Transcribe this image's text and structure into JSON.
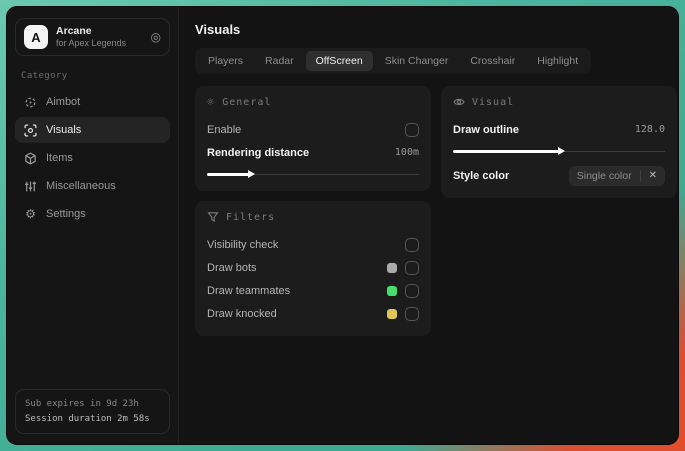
{
  "app": {
    "name": "Arcane",
    "subtitle": "for Apex Legends",
    "logo_letter": "A"
  },
  "sidebar": {
    "category_label": "Category",
    "items": [
      {
        "label": "Aimbot",
        "icon": "crosshair-icon",
        "active": false
      },
      {
        "label": "Visuals",
        "icon": "eye-scan-icon",
        "active": true
      },
      {
        "label": "Items",
        "icon": "cube-icon",
        "active": false
      },
      {
        "label": "Miscellaneous",
        "icon": "sliders-icon",
        "active": false
      },
      {
        "label": "Settings",
        "icon": "gear-icon",
        "active": false
      }
    ],
    "footer": {
      "sub_expires": "Sub expires in 9d 23h",
      "session_duration": "Session duration 2m 58s"
    }
  },
  "header": {
    "title": "Visuals"
  },
  "tabs": [
    {
      "label": "Players",
      "active": false
    },
    {
      "label": "Radar",
      "active": false
    },
    {
      "label": "OffScreen",
      "active": true
    },
    {
      "label": "Skin Changer",
      "active": false
    },
    {
      "label": "Crosshair",
      "active": false
    },
    {
      "label": "Highlight",
      "active": false
    }
  ],
  "panels": {
    "general": {
      "title": "General",
      "enable_label": "Enable",
      "enable_checked": false,
      "rendering_distance_label": "Rendering distance",
      "rendering_distance_value": "100m",
      "rendering_distance_percent": 20
    },
    "visual": {
      "title": "Visual",
      "draw_outline_label": "Draw outline",
      "draw_outline_value": "128.0",
      "draw_outline_percent": 50,
      "style_color_label": "Style color",
      "style_color_value": "Single color",
      "style_color_clear_icon": "✕"
    },
    "filters": {
      "title": "Filters",
      "rows": [
        {
          "label": "Visibility check",
          "swatch": null,
          "checked": false
        },
        {
          "label": "Draw bots",
          "swatch": "#a9a9a9",
          "checked": false
        },
        {
          "label": "Draw teammates",
          "swatch": "#4ade6d",
          "checked": false
        },
        {
          "label": "Draw knocked",
          "swatch": "#e2c653",
          "checked": false
        }
      ]
    }
  },
  "colors": {
    "accent_teal": "#49b59c",
    "accent_red": "#da4f31",
    "panel_bg": "#1c1c1c",
    "window_bg": "#131313"
  },
  "icons": {
    "brand_target": "◎",
    "general_header": "☼",
    "settings_gear": "⚙"
  }
}
